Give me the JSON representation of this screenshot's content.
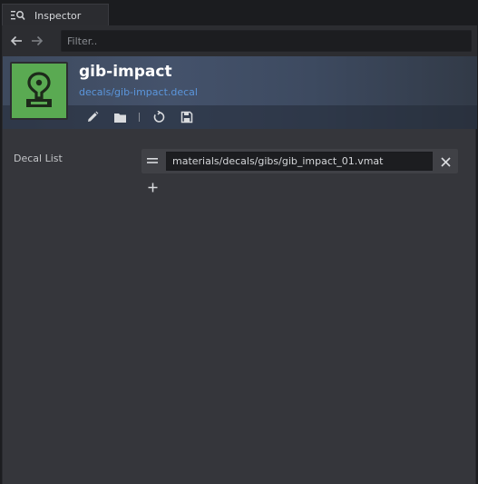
{
  "tab": {
    "title": "Inspector",
    "icon": "inspector-search-icon"
  },
  "toolbar": {
    "back_icon": "arrow-left-icon",
    "forward_icon": "arrow-right-icon",
    "filter_placeholder": "Filter..",
    "filter_value": ""
  },
  "asset": {
    "name": "gib-impact",
    "path": "decals/gib-impact.decal",
    "thumbnail_icon": "decal-stamp-icon",
    "thumbnail_color": "#5aaa52",
    "actions": [
      {
        "name": "edit",
        "icon": "pencil-icon"
      },
      {
        "name": "open-folder",
        "icon": "folder-icon"
      },
      {
        "name": "revert",
        "icon": "revert-icon"
      },
      {
        "name": "save",
        "icon": "save-icon"
      }
    ]
  },
  "properties": {
    "decal_list": {
      "label": "Decal List",
      "items": [
        {
          "value": "materials/decals/gibs/gib_impact_01.vmat"
        }
      ],
      "add_icon": "plus-icon",
      "remove_icon": "close-icon",
      "drag_icon": "drag-handle-icon"
    }
  },
  "colors": {
    "accent_link": "#5b96dc",
    "panel_bg": "#35363b"
  }
}
